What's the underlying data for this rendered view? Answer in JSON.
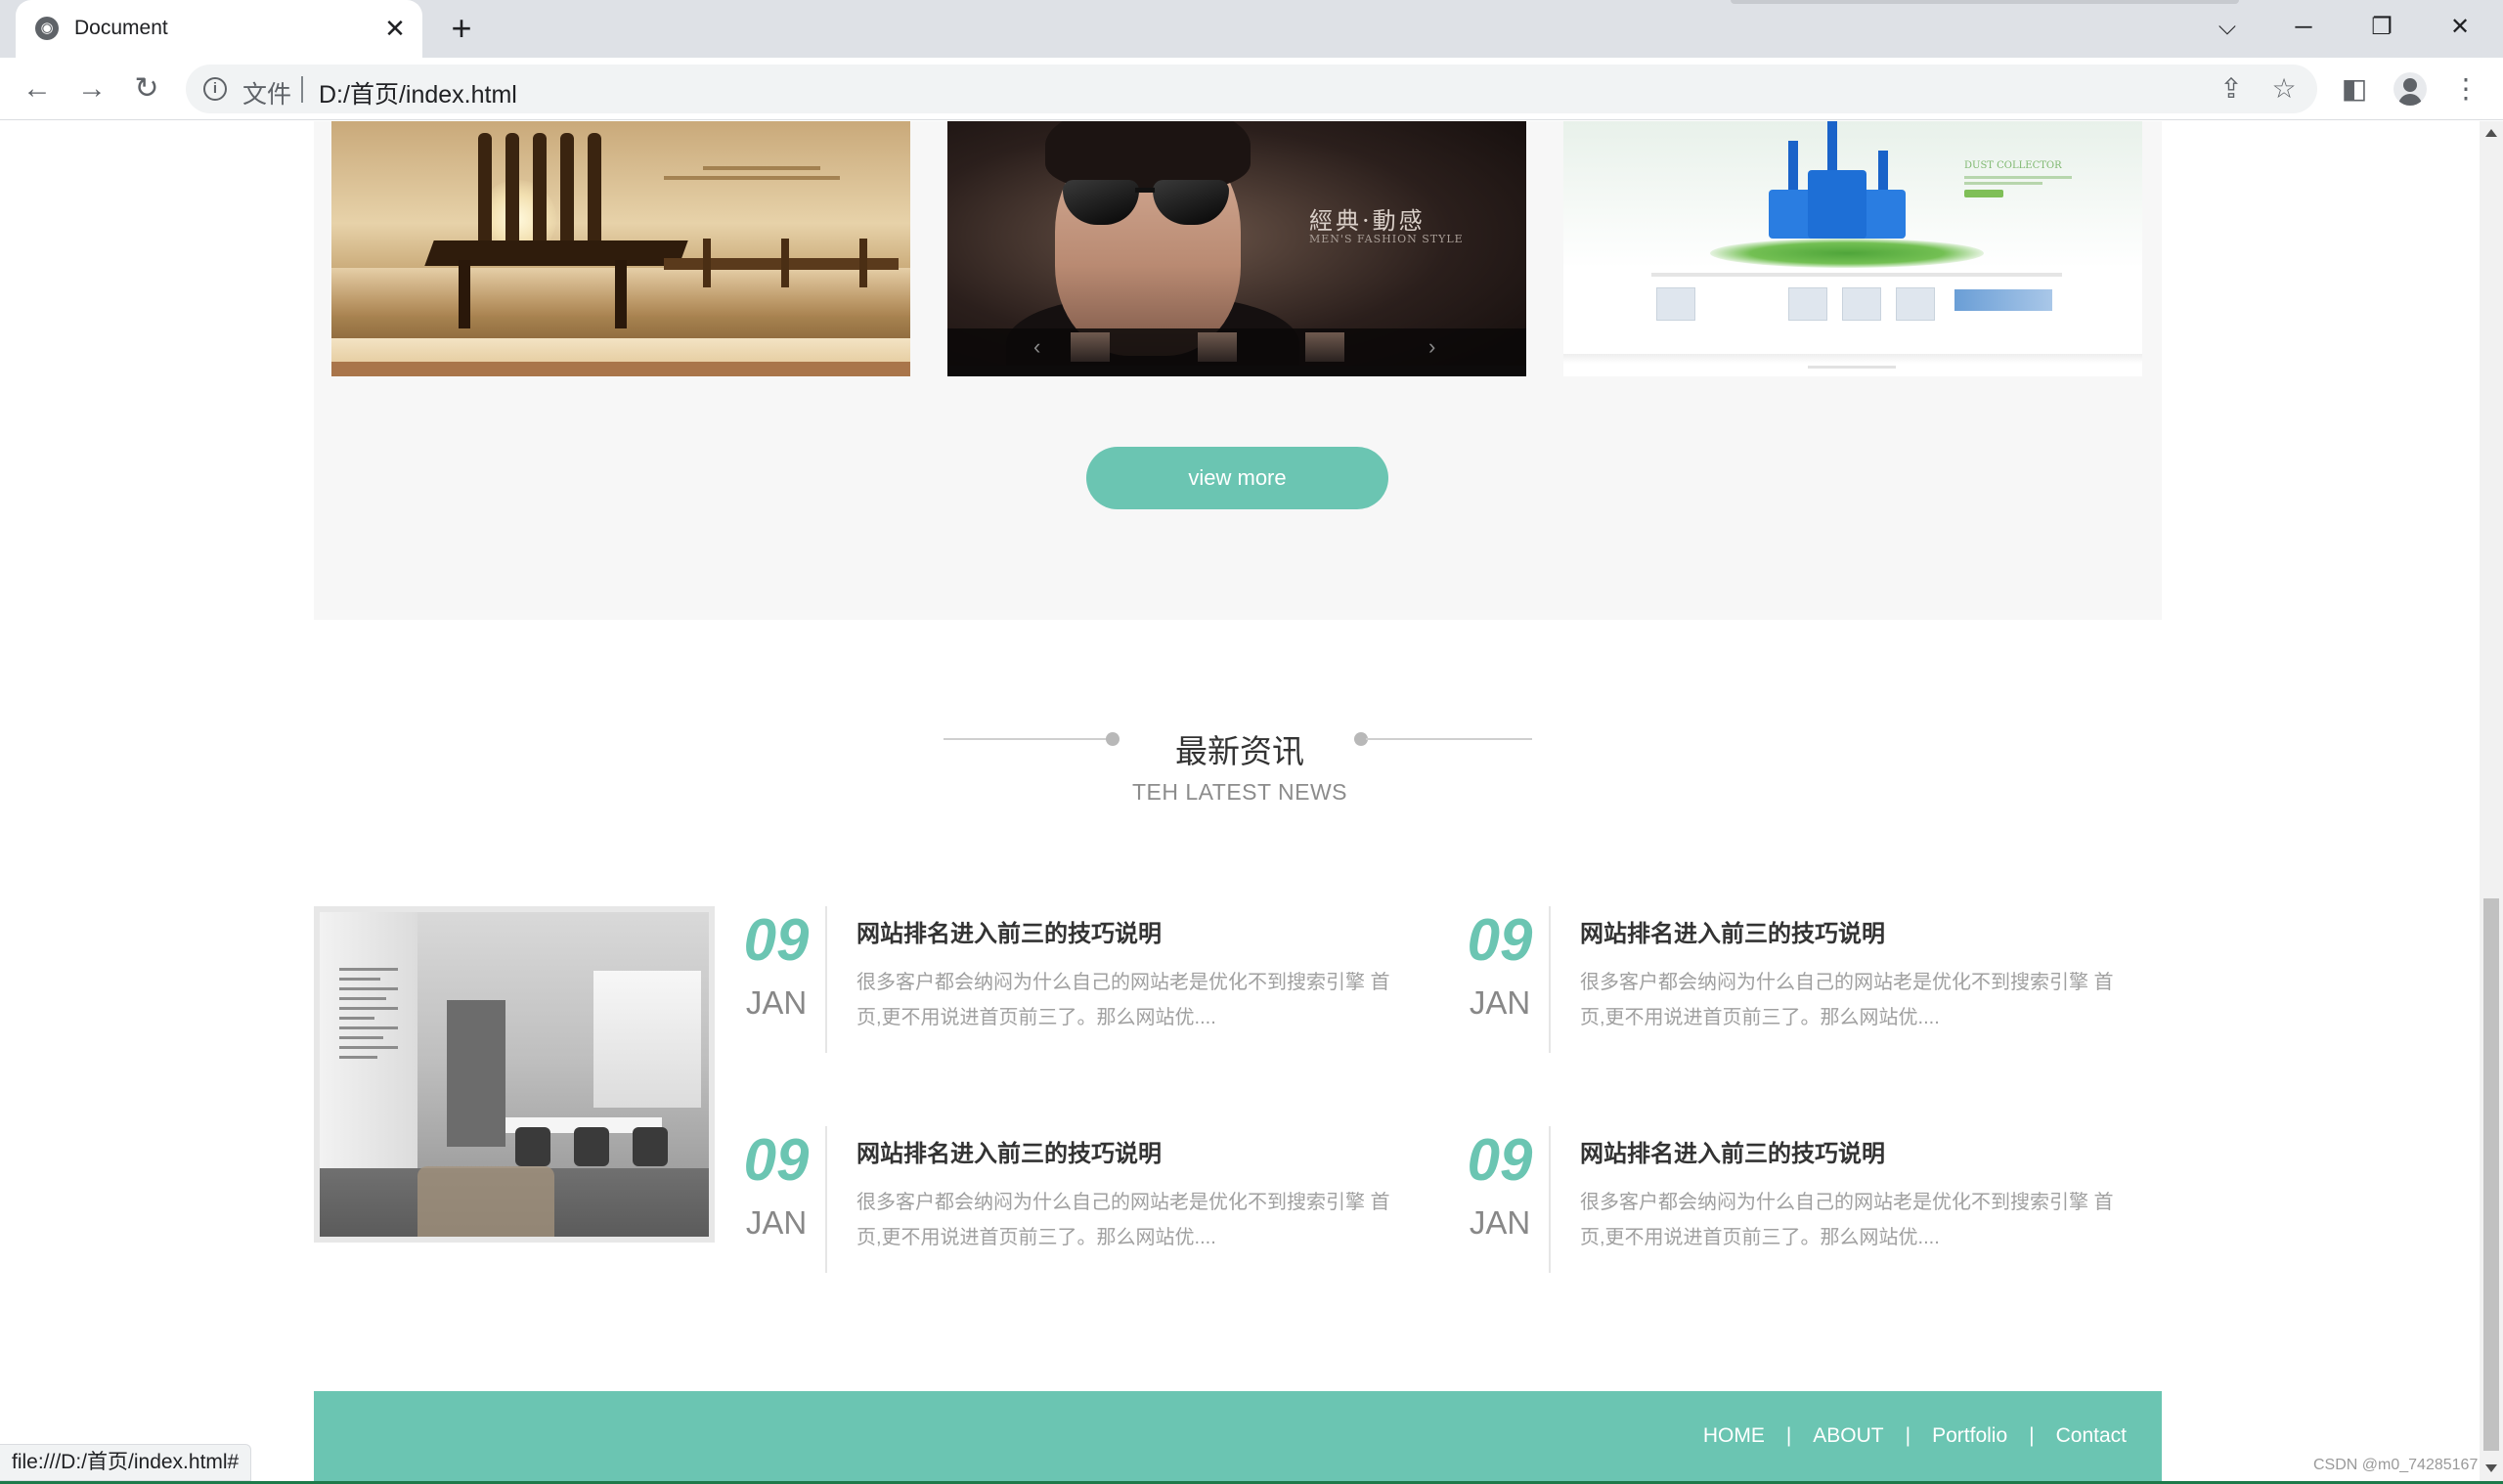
{
  "browser": {
    "tab_title": "Document",
    "tab_close": "✕",
    "new_tab": "+",
    "scheme_label": "文件",
    "url": "D:/首页/index.html",
    "status_url": "file:///D:/首页/index.html#",
    "watermark": "CSDN @m0_74285167"
  },
  "portfolio": {
    "view_more_label": "view more",
    "thumb2_title": "經典·動感",
    "thumb2_subtitle": "MEN'S FASHION STYLE",
    "thumb3_heading": "DUST COLLECTOR"
  },
  "news": {
    "title": "最新资讯",
    "subtitle": "TEH LATEST NEWS",
    "items": [
      {
        "day": "09",
        "month": "JAN",
        "title": "网站排名进入前三的技巧说明",
        "desc": "很多客户都会纳闷为什么自己的网站老是优化不到搜索引擎 首页,更不用说进首页前三了。那么网站优...."
      },
      {
        "day": "09",
        "month": "JAN",
        "title": "网站排名进入前三的技巧说明",
        "desc": "很多客户都会纳闷为什么自己的网站老是优化不到搜索引擎 首页,更不用说进首页前三了。那么网站优...."
      },
      {
        "day": "09",
        "month": "JAN",
        "title": "网站排名进入前三的技巧说明",
        "desc": "很多客户都会纳闷为什么自己的网站老是优化不到搜索引擎 首页,更不用说进首页前三了。那么网站优...."
      },
      {
        "day": "09",
        "month": "JAN",
        "title": "网站排名进入前三的技巧说明",
        "desc": "很多客户都会纳闷为什么自己的网站老是优化不到搜索引擎 首页,更不用说进首页前三了。那么网站优...."
      }
    ]
  },
  "footer": {
    "nav": [
      "HOME",
      "ABOUT",
      "Portfolio",
      "Contact"
    ],
    "separator": "|"
  },
  "colors": {
    "accent": "#6bc5b2",
    "section_bg": "#f7f7f7",
    "date_month": "#888888"
  }
}
